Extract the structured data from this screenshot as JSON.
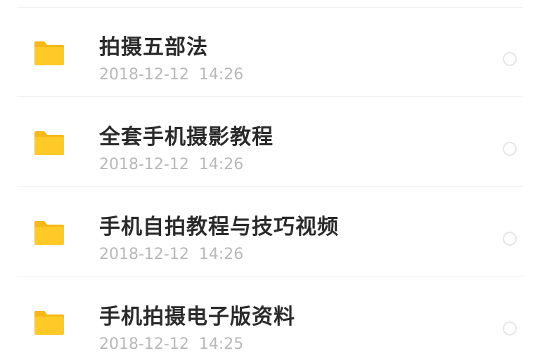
{
  "colors": {
    "folder": "#FFC928",
    "folder_tab": "#F6B816",
    "title_text": "#2b2b2b",
    "meta_text": "#b8b8b8",
    "radio_border": "#e6e6e6"
  },
  "files": [
    {
      "name": "拍摄五部法",
      "date": "2018-12-12",
      "time": "14:26",
      "icon": "folder-icon",
      "selected": false
    },
    {
      "name": "全套手机摄影教程",
      "date": "2018-12-12",
      "time": "14:26",
      "icon": "folder-icon",
      "selected": false
    },
    {
      "name": "手机自拍教程与技巧视频",
      "date": "2018-12-12",
      "time": "14:26",
      "icon": "folder-icon",
      "selected": false
    },
    {
      "name": "手机拍摄电子版资料",
      "date": "2018-12-12",
      "time": "14:25",
      "icon": "folder-icon",
      "selected": false
    }
  ]
}
